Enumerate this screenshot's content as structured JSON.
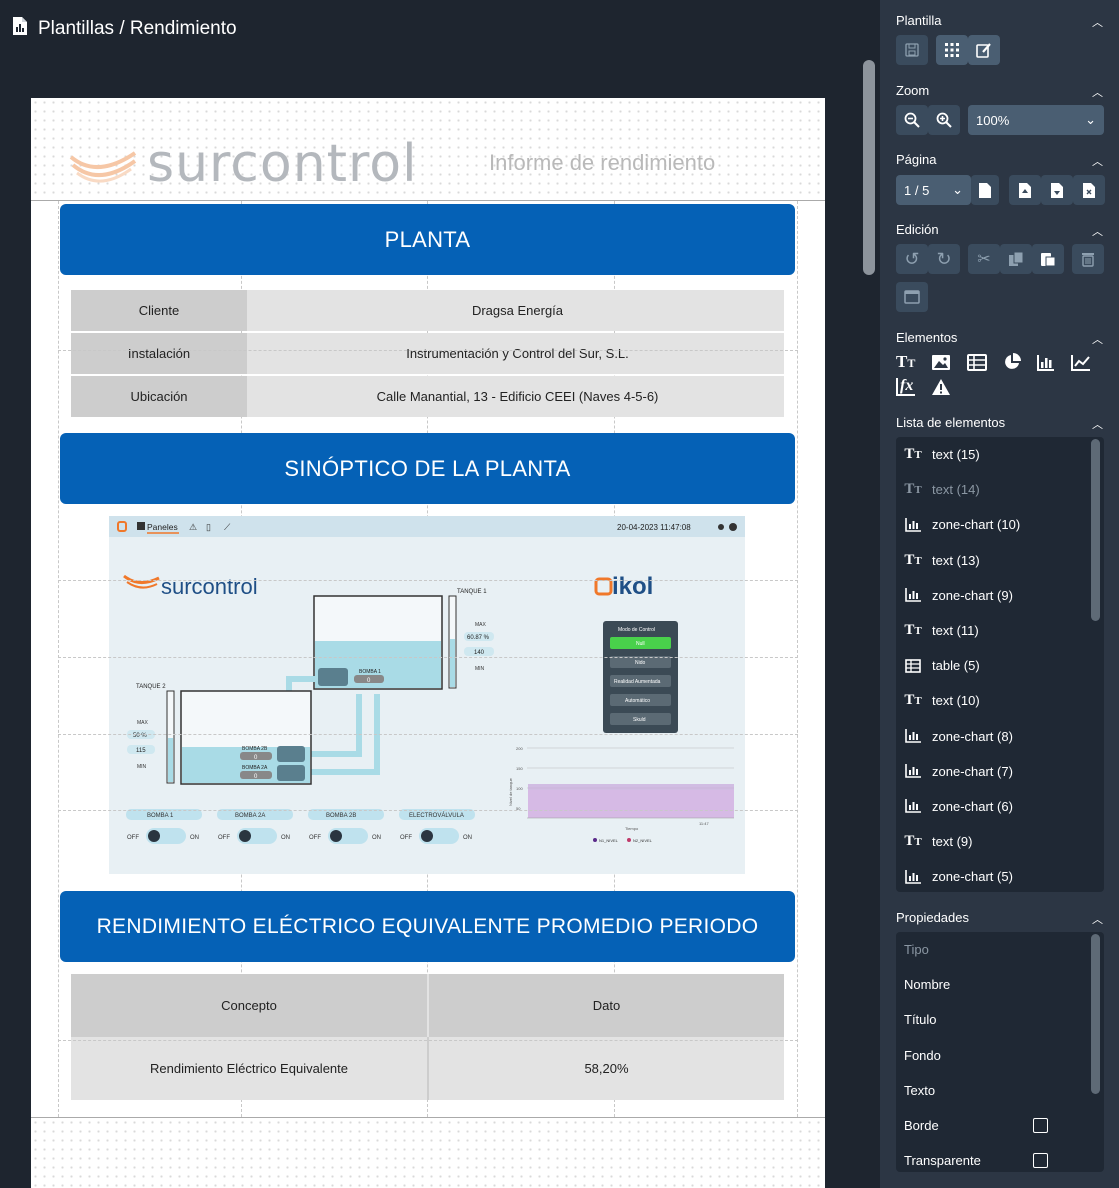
{
  "breadcrumb": "Plantillas / Rendimiento",
  "report": {
    "logo_text": "surcontrol",
    "header_title": "Informe de rendimiento",
    "sections": {
      "planta": "PLANTA",
      "sinoptico": "SINÓPTICO DE LA PLANTA",
      "rendimiento": "RENDIMIENTO ELÉCTRICO EQUIVALENTE PROMEDIO PERIODO"
    },
    "info_table": [
      {
        "label": "Cliente",
        "value": "Dragsa Energía"
      },
      {
        "label": "Instalación",
        "value": "Instrumentación y Control del Sur, S.L."
      },
      {
        "label": "Ubicación",
        "value": "Calle Manantial, 13 - Edificio CEEI (Naves 4-5-6)"
      }
    ],
    "perf_table": {
      "headers": [
        "Concepto",
        "Dato"
      ],
      "rows": [
        [
          "Rendimiento Eléctrico Equivalente",
          "58,20%"
        ]
      ]
    },
    "synoptic": {
      "nav_label": "Paneles",
      "datetime": "20-04-2023  11:47:08",
      "logo_left": "surcontrol",
      "logo_right": "ikol",
      "tank1": {
        "label": "TANQUE 1",
        "max": "MAX",
        "min": "MIN",
        "pct": "60.87 %",
        "val": "140"
      },
      "tank2": {
        "label": "TANQUE 2",
        "max": "MAX",
        "min": "MIN",
        "pct": "50 %",
        "val": "115"
      },
      "pumps": [
        "BOMBA 1",
        "BOMBA 2B",
        "BOMBA 2A"
      ],
      "pump_vals": [
        "0",
        "0",
        "0"
      ],
      "control": {
        "title": "Modo de Control",
        "buttons": [
          "Null",
          "Nido",
          "Realidad Aumentada",
          "Automático",
          "Skuld"
        ]
      },
      "toggles": [
        {
          "label": "BOMBA 1",
          "off": "OFF",
          "on": "ON"
        },
        {
          "label": "BOMBA 2A",
          "off": "OFF",
          "on": "ON"
        },
        {
          "label": "BOMBA 2B",
          "off": "OFF",
          "on": "ON"
        },
        {
          "label": "ELECTROVÁLVULA",
          "off": "OFF",
          "on": "ON"
        }
      ],
      "mini_chart": {
        "yticks": [
          "200",
          "150",
          "100",
          "50"
        ],
        "ylabel": "Nivel de tanque",
        "xlabel": "Tiempo",
        "xtick": "11:47",
        "legend": [
          "N1_NIVEL",
          "N2_NIVEL"
        ]
      }
    }
  },
  "panel": {
    "plantilla": "Plantilla",
    "zoom": "Zoom",
    "zoom_value": "100%",
    "pagina": "Página",
    "page_value": "1 / 5",
    "edicion": "Edición",
    "elementos": "Elementos",
    "lista": "Lista de elementos",
    "items": [
      {
        "icon": "text-icon",
        "label": "text (15)",
        "dim": false
      },
      {
        "icon": "text-icon",
        "label": "text (14)",
        "dim": true
      },
      {
        "icon": "bar-chart-icon",
        "label": "zone-chart (10)",
        "dim": false
      },
      {
        "icon": "text-icon",
        "label": "text (13)",
        "dim": false
      },
      {
        "icon": "bar-chart-icon",
        "label": "zone-chart (9)",
        "dim": false
      },
      {
        "icon": "text-icon",
        "label": "text (11)",
        "dim": false
      },
      {
        "icon": "table-icon",
        "label": "table (5)",
        "dim": false
      },
      {
        "icon": "text-icon",
        "label": "text (10)",
        "dim": false
      },
      {
        "icon": "bar-chart-icon",
        "label": "zone-chart (8)",
        "dim": false
      },
      {
        "icon": "bar-chart-icon",
        "label": "zone-chart (7)",
        "dim": false
      },
      {
        "icon": "bar-chart-icon",
        "label": "zone-chart (6)",
        "dim": false
      },
      {
        "icon": "text-icon",
        "label": "text (9)",
        "dim": false
      },
      {
        "icon": "bar-chart-icon",
        "label": "zone-chart (5)",
        "dim": false
      }
    ],
    "propiedades": "Propiedades",
    "props": [
      {
        "label": "Tipo",
        "dim": true,
        "checkbox": false
      },
      {
        "label": "Nombre",
        "dim": false,
        "checkbox": false
      },
      {
        "label": "Título",
        "dim": false,
        "checkbox": false
      },
      {
        "label": "Fondo",
        "dim": false,
        "checkbox": false
      },
      {
        "label": "Texto",
        "dim": false,
        "checkbox": false
      },
      {
        "label": "Borde",
        "dim": false,
        "checkbox": true
      },
      {
        "label": "Transparente",
        "dim": false,
        "checkbox": true
      }
    ]
  },
  "colors": {
    "band": "#0561b6",
    "panel_bg": "#2c3644",
    "app_bg": "#1e252f",
    "accent_orange": "#f0782a"
  }
}
